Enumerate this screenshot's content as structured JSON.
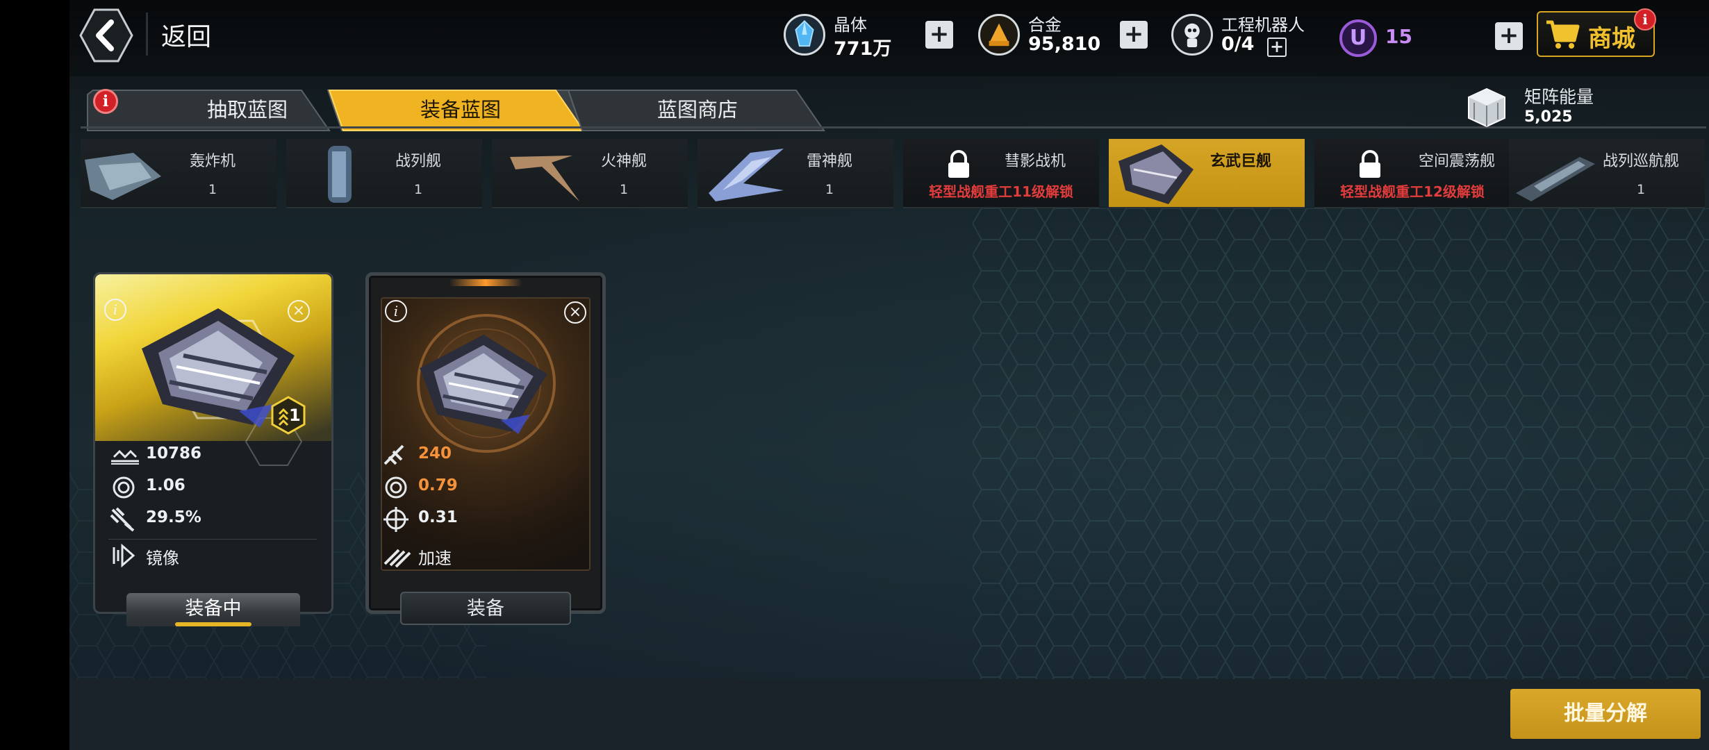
{
  "header": {
    "back_label": "返回",
    "resources": [
      {
        "name": "晶体",
        "value": "771万",
        "icon": "crystal-icon"
      },
      {
        "name": "合金",
        "value": "95,810",
        "icon": "alloy-icon"
      },
      {
        "name": "工程机器人",
        "value": "0/4",
        "icon": "robot-icon"
      }
    ],
    "premium": {
      "icon": "u-coin-icon",
      "symbol": "U",
      "value": "15"
    },
    "shop": {
      "label": "商城",
      "badge": "i"
    }
  },
  "tabs": {
    "items": [
      {
        "label": "抽取蓝图",
        "badge": "i",
        "active": false
      },
      {
        "label": "装备蓝图",
        "active": true
      },
      {
        "label": "蓝图商店",
        "active": false
      }
    ]
  },
  "matrix_energy": {
    "name": "矩阵能量",
    "value": "5,025"
  },
  "ship_tabs": [
    {
      "name": "轰炸机",
      "count": "1",
      "state": "normal"
    },
    {
      "name": "战列舰",
      "count": "1",
      "state": "normal"
    },
    {
      "name": "火神舰",
      "count": "1",
      "state": "normal"
    },
    {
      "name": "雷神舰",
      "count": "1",
      "state": "normal"
    },
    {
      "name": "彗影战机",
      "unlock": "轻型战舰重工11级解锁",
      "state": "locked"
    },
    {
      "name": "玄武巨舰",
      "count": "",
      "state": "active"
    },
    {
      "name": "空间震荡舰",
      "unlock": "轻型战舰重工12级解锁",
      "state": "locked"
    },
    {
      "name": "战列巡航舰",
      "count": "1",
      "state": "normal"
    }
  ],
  "cards": [
    {
      "info_icon": "i",
      "close_icon": "×",
      "rank": "1",
      "stats": [
        {
          "icon": "attack-icon",
          "value": "10786"
        },
        {
          "icon": "fire-rate-icon",
          "value": "1.06"
        },
        {
          "icon": "missile-icon",
          "value": "29.5%"
        }
      ],
      "skill": {
        "icon": "mirror-icon",
        "label": "镜像"
      },
      "button": "装备中"
    },
    {
      "info_icon": "i",
      "close_icon": "×",
      "stats": [
        {
          "icon": "attack-icon",
          "value": "240"
        },
        {
          "icon": "fire-rate-icon",
          "value": "0.79"
        },
        {
          "icon": "accuracy-icon",
          "value": "0.31"
        }
      ],
      "skill": {
        "icon": "speed-icon",
        "label": "加速"
      },
      "button": "装备"
    }
  ],
  "footer": {
    "decompose_label": "批量分解"
  },
  "colors": {
    "accent": "#d6a526",
    "locked_text": "#e33c3c",
    "stat_orange": "#f5923a",
    "premium": "#c98df4"
  }
}
